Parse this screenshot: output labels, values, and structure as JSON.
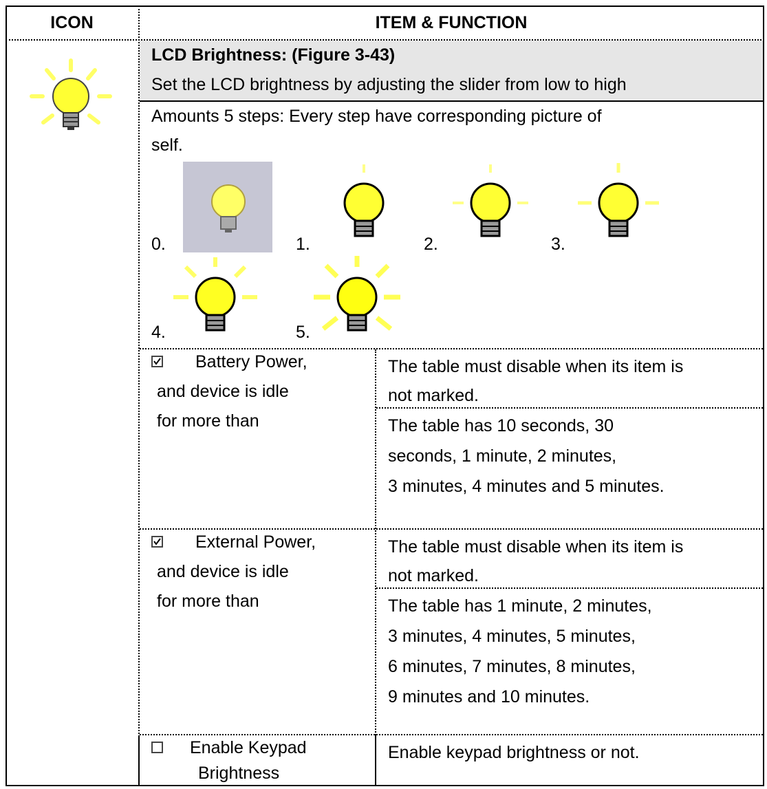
{
  "header": {
    "icon_col": "ICON",
    "item_col": "ITEM & FUNCTION"
  },
  "lcd": {
    "title": "LCD Brightness: (Figure 3-43)",
    "desc": "Set the LCD brightness by adjusting the slider from low to high",
    "steps_line1": "Amounts 5 steps: Every step have corresponding picture of",
    "steps_line2": "self.",
    "step_labels": [
      "0.",
      "1.",
      "2.",
      "3.",
      "4.",
      "5."
    ]
  },
  "battery": {
    "checked": true,
    "label": [
      "Battery Power,",
      "and device is idle",
      "for more than"
    ],
    "note": [
      "The table must disable when its item is",
      "not marked."
    ],
    "options": [
      "The table has 10 seconds, 30",
      "seconds, 1 minute, 2 minutes,",
      "3 minutes, 4 minutes and 5 minutes."
    ]
  },
  "external": {
    "checked": true,
    "label": [
      "External Power,",
      "and device is idle",
      "for more than"
    ],
    "note": [
      "The table must disable when its item is",
      "not marked."
    ],
    "options": [
      "The table has 1 minute, 2 minutes,",
      "3 minutes, 4 minutes, 5 minutes,",
      "6 minutes, 7 minutes, 8 minutes,",
      "9 minutes and 10 minutes."
    ]
  },
  "keypad": {
    "checked": false,
    "label": [
      "Enable Keypad",
      "Brightness"
    ],
    "desc": "Enable keypad brightness or not."
  },
  "colors": {
    "bulb": "#ffff33",
    "ray": "#ffff66",
    "shade": "#e6e6e6"
  },
  "icons": {
    "main": "lightbulb-icon",
    "checkbox": "checkbox-icon"
  }
}
